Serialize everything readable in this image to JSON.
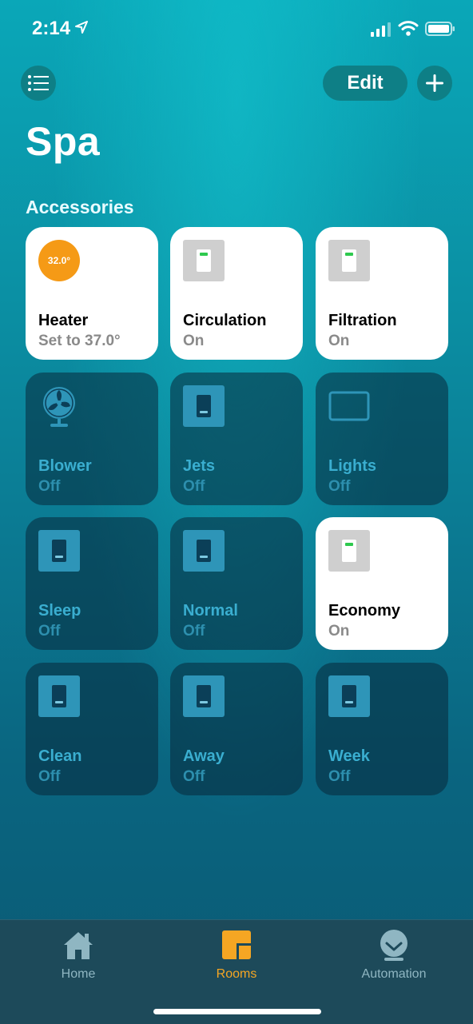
{
  "status": {
    "time": "2:14"
  },
  "header": {
    "edit_label": "Edit",
    "title": "Spa"
  },
  "section_label": "Accessories",
  "tiles": [
    {
      "name": "Heater",
      "status": "Set to 37.0°",
      "state": "on",
      "icon": "thermostat-icon",
      "dial": "32.0°"
    },
    {
      "name": "Circulation",
      "status": "On",
      "state": "on",
      "icon": "switch-icon"
    },
    {
      "name": "Filtration",
      "status": "On",
      "state": "on",
      "icon": "switch-icon"
    },
    {
      "name": "Blower",
      "status": "Off",
      "state": "off",
      "icon": "fan-icon"
    },
    {
      "name": "Jets",
      "status": "Off",
      "state": "off",
      "icon": "switch-icon"
    },
    {
      "name": "Lights",
      "status": "Off",
      "state": "off",
      "icon": "light-panel-icon"
    },
    {
      "name": "Sleep",
      "status": "Off",
      "state": "off",
      "icon": "switch-icon"
    },
    {
      "name": "Normal",
      "status": "Off",
      "state": "off",
      "icon": "switch-icon"
    },
    {
      "name": "Economy",
      "status": "On",
      "state": "on",
      "icon": "switch-icon"
    },
    {
      "name": "Clean",
      "status": "Off",
      "state": "off",
      "icon": "switch-icon"
    },
    {
      "name": "Away",
      "status": "Off",
      "state": "off",
      "icon": "switch-icon"
    },
    {
      "name": "Week",
      "status": "Off",
      "state": "off",
      "icon": "switch-icon"
    }
  ],
  "tabs": [
    {
      "label": "Home",
      "icon": "home-icon",
      "color": "#8fb6c2"
    },
    {
      "label": "Rooms",
      "icon": "rooms-icon",
      "color": "#f5a623",
      "selected": true
    },
    {
      "label": "Automation",
      "icon": "automation-icon",
      "color": "#8fb6c2"
    }
  ]
}
